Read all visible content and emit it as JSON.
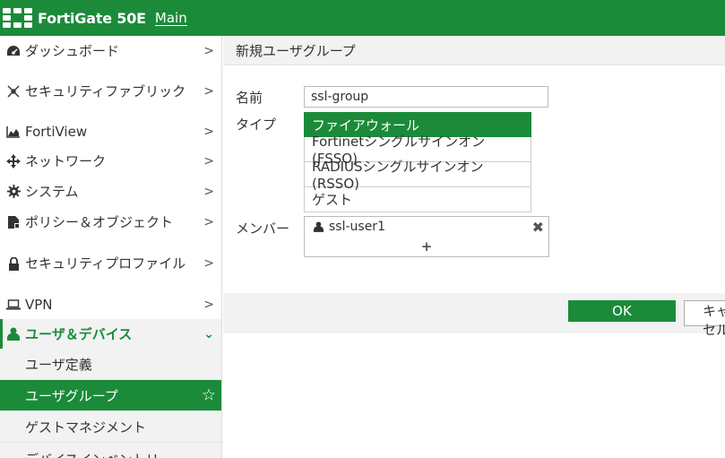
{
  "header": {
    "product": "FortiGate 50E",
    "vdom": "Main"
  },
  "sidebar": {
    "items": [
      {
        "label": "ダッシュボード",
        "icon": "dashboard-icon",
        "chevron": ">"
      },
      {
        "label": "セキュリティファブリック",
        "icon": "fabric-icon",
        "chevron": ">"
      },
      {
        "label": "FortiView",
        "icon": "fortiview-icon",
        "chevron": ">"
      },
      {
        "label": "ネットワーク",
        "icon": "network-icon",
        "chevron": ">"
      },
      {
        "label": "システム",
        "icon": "gear-icon",
        "chevron": ">"
      },
      {
        "label": "ポリシー＆オブジェクト",
        "icon": "policy-icon",
        "chevron": ">"
      },
      {
        "label": "セキュリティプロファイル",
        "icon": "lock-icon",
        "chevron": ">"
      },
      {
        "label": "VPN",
        "icon": "laptop-icon",
        "chevron": ">"
      },
      {
        "label": "ユーザ＆デバイス",
        "icon": "user-icon",
        "chevron": "⌄"
      }
    ],
    "subitems": [
      {
        "label": "ユーザ定義"
      },
      {
        "label": "ユーザグループ",
        "star": "☆"
      },
      {
        "label": "ゲストマネジメント"
      },
      {
        "label": "デバイスインベントリ"
      }
    ]
  },
  "main": {
    "title": "新規ユーザグループ",
    "form": {
      "name_label": "名前",
      "name_value": "ssl-group",
      "type_label": "タイプ",
      "type_options": [
        "ファイアウォール",
        "Fortinetシングルサインオン(FSSO)",
        "RADIUSシングルサインオン(RSSO)",
        "ゲスト"
      ],
      "members_label": "メンバー",
      "member": "ssl-user1",
      "remove_glyph": "✖",
      "add_glyph": "+"
    },
    "buttons": {
      "ok": "OK",
      "cancel": "キャンセル"
    }
  },
  "colors": {
    "brand": "#1b8b3a",
    "panel": "#f2f2f2"
  }
}
